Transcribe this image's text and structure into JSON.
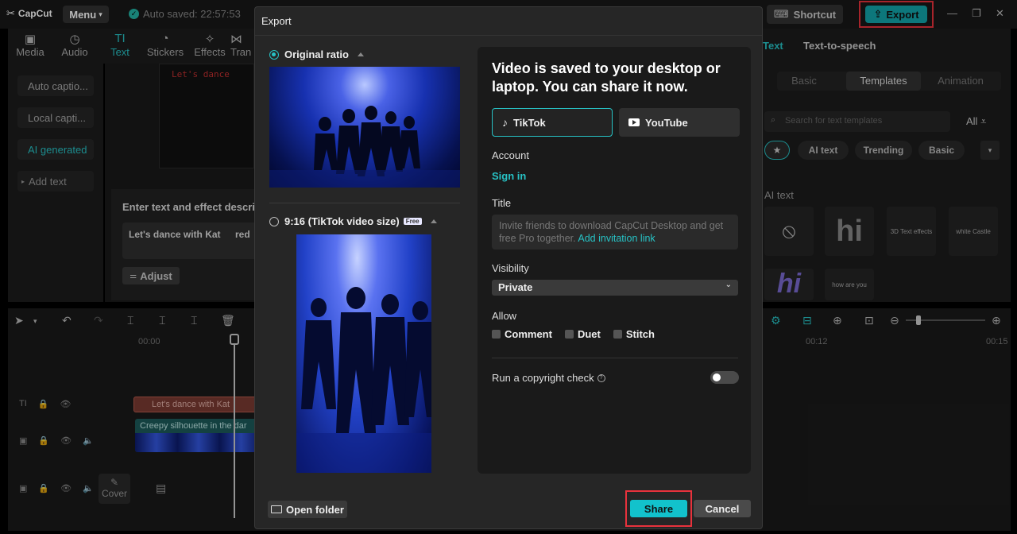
{
  "app": {
    "logo_text": "CapCut",
    "menu_label": "Menu",
    "autosave_text": "Auto saved: 22:57:53",
    "shortcut_label": "Shortcut",
    "export_label": "Export"
  },
  "media_tabs": [
    {
      "label": "Media",
      "icon": "media-icon"
    },
    {
      "label": "Audio",
      "icon": "audio-icon"
    },
    {
      "label": "Text",
      "icon": "text-icon",
      "active": true
    },
    {
      "label": "Stickers",
      "icon": "stickers-icon"
    },
    {
      "label": "Effects",
      "icon": "effects-icon"
    },
    {
      "label": "Tran",
      "icon": "transitions-icon"
    }
  ],
  "left_sidebar": [
    {
      "label": "Auto captio..."
    },
    {
      "label": "Local capti..."
    },
    {
      "label": "AI generated",
      "active": true
    },
    {
      "label": "Add text"
    }
  ],
  "left_content": {
    "preview_text": "Let's dance",
    "prompt_label": "Enter text and effect descrip",
    "prompt_card": "Let's dance with Kat",
    "prompt_card2": "red",
    "adjust_label": "Adjust"
  },
  "right_panel": {
    "tabs": [
      "Text",
      "Text-to-speech"
    ],
    "segments": [
      "Basic",
      "Templates",
      "Animation"
    ],
    "search_placeholder": "Search for text templates",
    "all_label": "All",
    "chips": [
      "AI text",
      "Trending",
      "Basic"
    ],
    "section_label": "AI text",
    "templates": [
      "hi",
      "3D Text effects",
      "white Castle",
      "hi",
      "how are you"
    ]
  },
  "timeline": {
    "ruler": [
      "00:00",
      "00:12",
      "00:15"
    ],
    "text_clip": "Let's dance with Kat",
    "video_clip": "Creepy silhouette in the dar",
    "cover_label": "Cover"
  },
  "modal": {
    "title": "Export",
    "option1": "Original ratio",
    "option2": "9:16 (TikTok video size)",
    "free_badge": "Free",
    "heading": "Video is saved to your desktop or laptop. You can share it now.",
    "platforms": [
      "TikTok",
      "YouTube"
    ],
    "account_label": "Account",
    "signin_label": "Sign in",
    "title_label": "Title",
    "title_placeholder": "Invite friends to download CapCut Desktop and get free Pro together.",
    "title_link": "Add invitation link",
    "visibility_label": "Visibility",
    "visibility_value": "Private",
    "allow_label": "Allow",
    "allow_options": [
      "Comment",
      "Duet",
      "Stitch"
    ],
    "copyright_label": "Run a copyright check",
    "open_folder": "Open folder",
    "share": "Share",
    "cancel": "Cancel"
  },
  "colors": {
    "accent": "#27c2c5",
    "highlight": "#e8323c",
    "panel": "#1a1a1a"
  }
}
